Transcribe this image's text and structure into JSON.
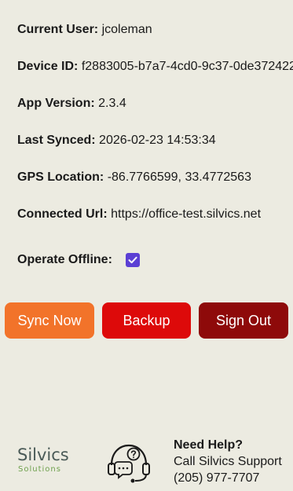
{
  "info": {
    "current_user_label": "Current User:",
    "current_user_value": "jcoleman",
    "device_id_label": "Device ID:",
    "device_id_value": "f2883005-b7a7-4cd0-9c37-0de372422",
    "app_version_label": "App Version:",
    "app_version_value": "2.3.4",
    "last_synced_label": "Last Synced:",
    "last_synced_value": "2026-02-23 14:53:34",
    "gps_label": "GPS Location:",
    "gps_value": "-86.7766599, 33.4772563",
    "connected_url_label": "Connected Url:",
    "connected_url_value": "https://office-test.silvics.net"
  },
  "offline": {
    "label": "Operate Offline:",
    "checked": true
  },
  "buttons": {
    "sync_label": "Sync Now",
    "backup_label": "Backup",
    "signout_label": "Sign Out"
  },
  "colors": {
    "background": "#ecebe1",
    "sync": "#f2732a",
    "backup": "#dd0a0a",
    "signout": "#8e0a0a",
    "checkbox": "#5b3fd4",
    "logo_text": "#4a5a57",
    "logo_sub": "#6fa14e"
  },
  "footer": {
    "logo_main": "Silvics",
    "logo_sub": "Solutions",
    "support_icon": "headset-help-icon",
    "help_title": "Need Help?",
    "help_line1": "Call Silvics Support",
    "help_phone": "(205) 977-7707"
  }
}
